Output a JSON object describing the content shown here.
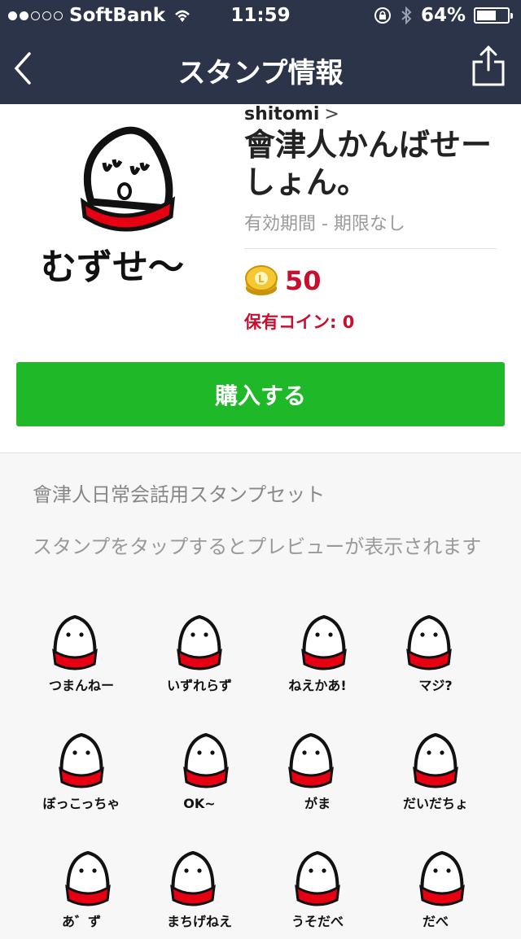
{
  "status_bar": {
    "carrier": "SoftBank",
    "time": "11:59",
    "battery": "64%",
    "battery_level": 0.64,
    "signal_bars": 2
  },
  "nav": {
    "title": "スタンプ情報"
  },
  "product": {
    "author": "shitomi",
    "author_chevron": ">",
    "title": "會津人かんばせーしょん。",
    "period": "有効期間 - 期限なし",
    "price": "50",
    "owned_coins": "保有コイン: 0",
    "buy_label": "購入する",
    "thumbnail_text": "むずせ〜"
  },
  "sticker_set": {
    "title": "會津人日常会話用スタンプセット",
    "hint": "スタンプをタップするとプレビューが表示されます",
    "stickers": [
      {
        "text": "つまんねー"
      },
      {
        "text": "いずれらず"
      },
      {
        "text": "ねえかあ!"
      },
      {
        "text": "マジ?"
      },
      {
        "text": "ぼっこっちゃ"
      },
      {
        "text": "OK~"
      },
      {
        "text": "がま"
      },
      {
        "text": "だいだちょ"
      },
      {
        "text": "あ゛ず"
      },
      {
        "text": "まちげねえ"
      },
      {
        "text": "うそだべ"
      },
      {
        "text": "だべ"
      }
    ]
  },
  "colors": {
    "nav_bg": "#2b3448",
    "buy_green": "#1fb828",
    "price_red": "#c8102e",
    "sticker_red": "#e60012"
  }
}
